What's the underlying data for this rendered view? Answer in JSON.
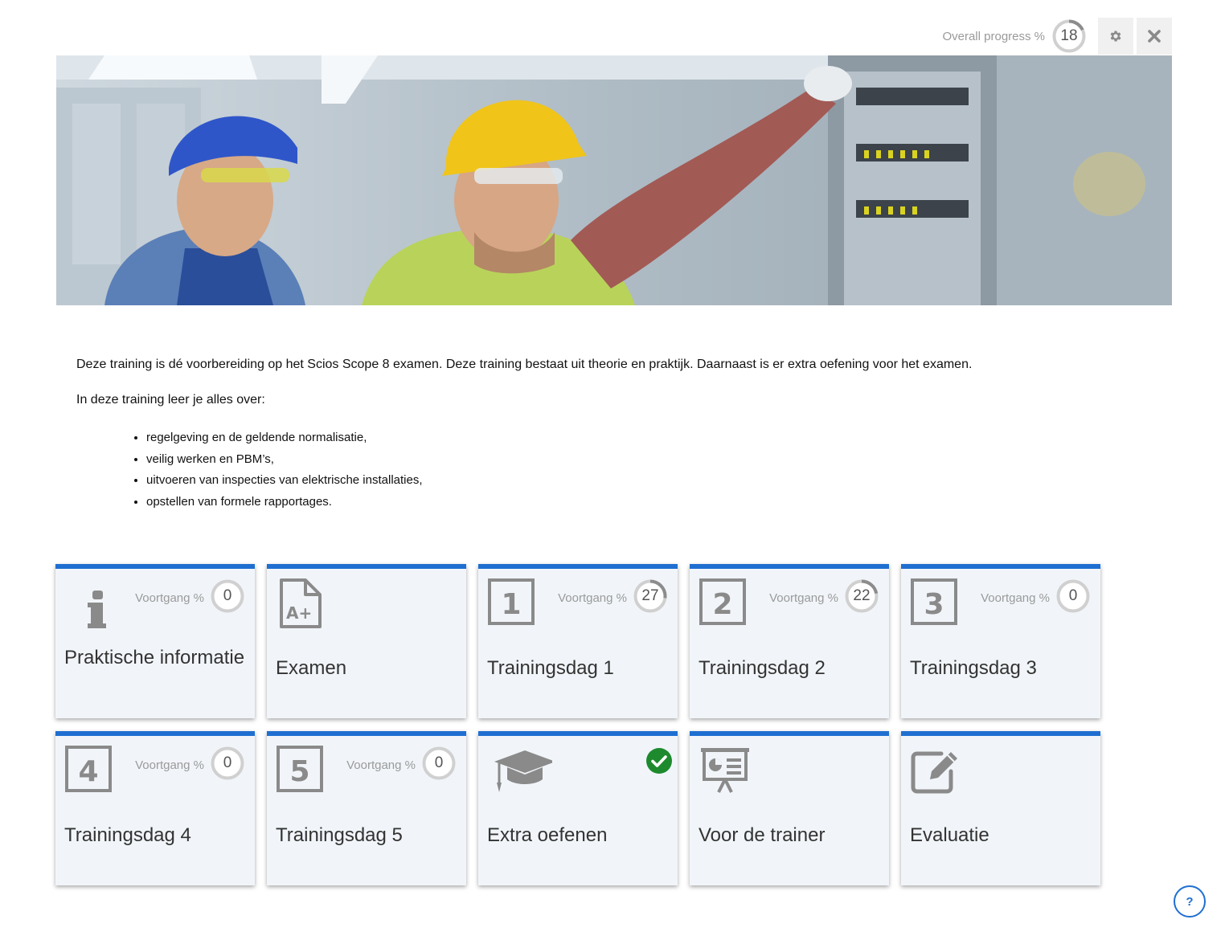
{
  "header": {
    "overall_label": "Overall progress %",
    "overall_value": "18",
    "overall_fraction": 0.18,
    "settings_icon": "gear-icon",
    "close_icon": "close-icon"
  },
  "hero": {
    "alt": "Twee technici met helm bij een elektrische schakelkast"
  },
  "intro": {
    "paragraph1": "Deze training is dé voorbereiding op het Scios Scope 8 examen. Deze training bestaat uit theorie en praktijk. Daarnaast is er extra oefening voor het examen.",
    "paragraph2": "In deze training leer je alles over:",
    "bullets": [
      "regelgeving en de geldende normalisatie,",
      "veilig werken en PBM’s,",
      "uitvoeren van inspecties van elektrische installaties,",
      "opstellen van formele rapportages."
    ]
  },
  "tiles": [
    {
      "title": "Praktische informatie",
      "icon": "info-icon",
      "progress_label": "Voortgang %",
      "progress": "0",
      "fraction": 0
    },
    {
      "title": "Examen",
      "icon": "exam-grade-icon"
    },
    {
      "title": "Trainingsdag 1",
      "icon": "number-1-icon",
      "progress_label": "Voortgang %",
      "progress": "27",
      "fraction": 0.27
    },
    {
      "title": "Trainingsdag 2",
      "icon": "number-2-icon",
      "progress_label": "Voortgang %",
      "progress": "22",
      "fraction": 0.22
    },
    {
      "title": "Trainingsdag 3",
      "icon": "number-3-icon",
      "progress_label": "Voortgang %",
      "progress": "0",
      "fraction": 0
    },
    {
      "title": "Trainingsdag 4",
      "icon": "number-4-icon",
      "progress_label": "Voortgang %",
      "progress": "0",
      "fraction": 0
    },
    {
      "title": "Trainingsdag 5",
      "icon": "number-5-icon",
      "progress_label": "Voortgang %",
      "progress": "0",
      "fraction": 0
    },
    {
      "title": "Extra oefenen",
      "icon": "graduation-cap-icon",
      "completed": true
    },
    {
      "title": "Voor de trainer",
      "icon": "presentation-icon"
    },
    {
      "title": "Evaluatie",
      "icon": "edit-icon"
    }
  ],
  "help": {
    "label": "?"
  },
  "colors": {
    "accent": "#1f6fd1",
    "tile_bg": "#f1f5f9",
    "ring_track": "#d0d0d0",
    "ring_fill": "#8c8c8c",
    "check": "#1e8a2e"
  }
}
